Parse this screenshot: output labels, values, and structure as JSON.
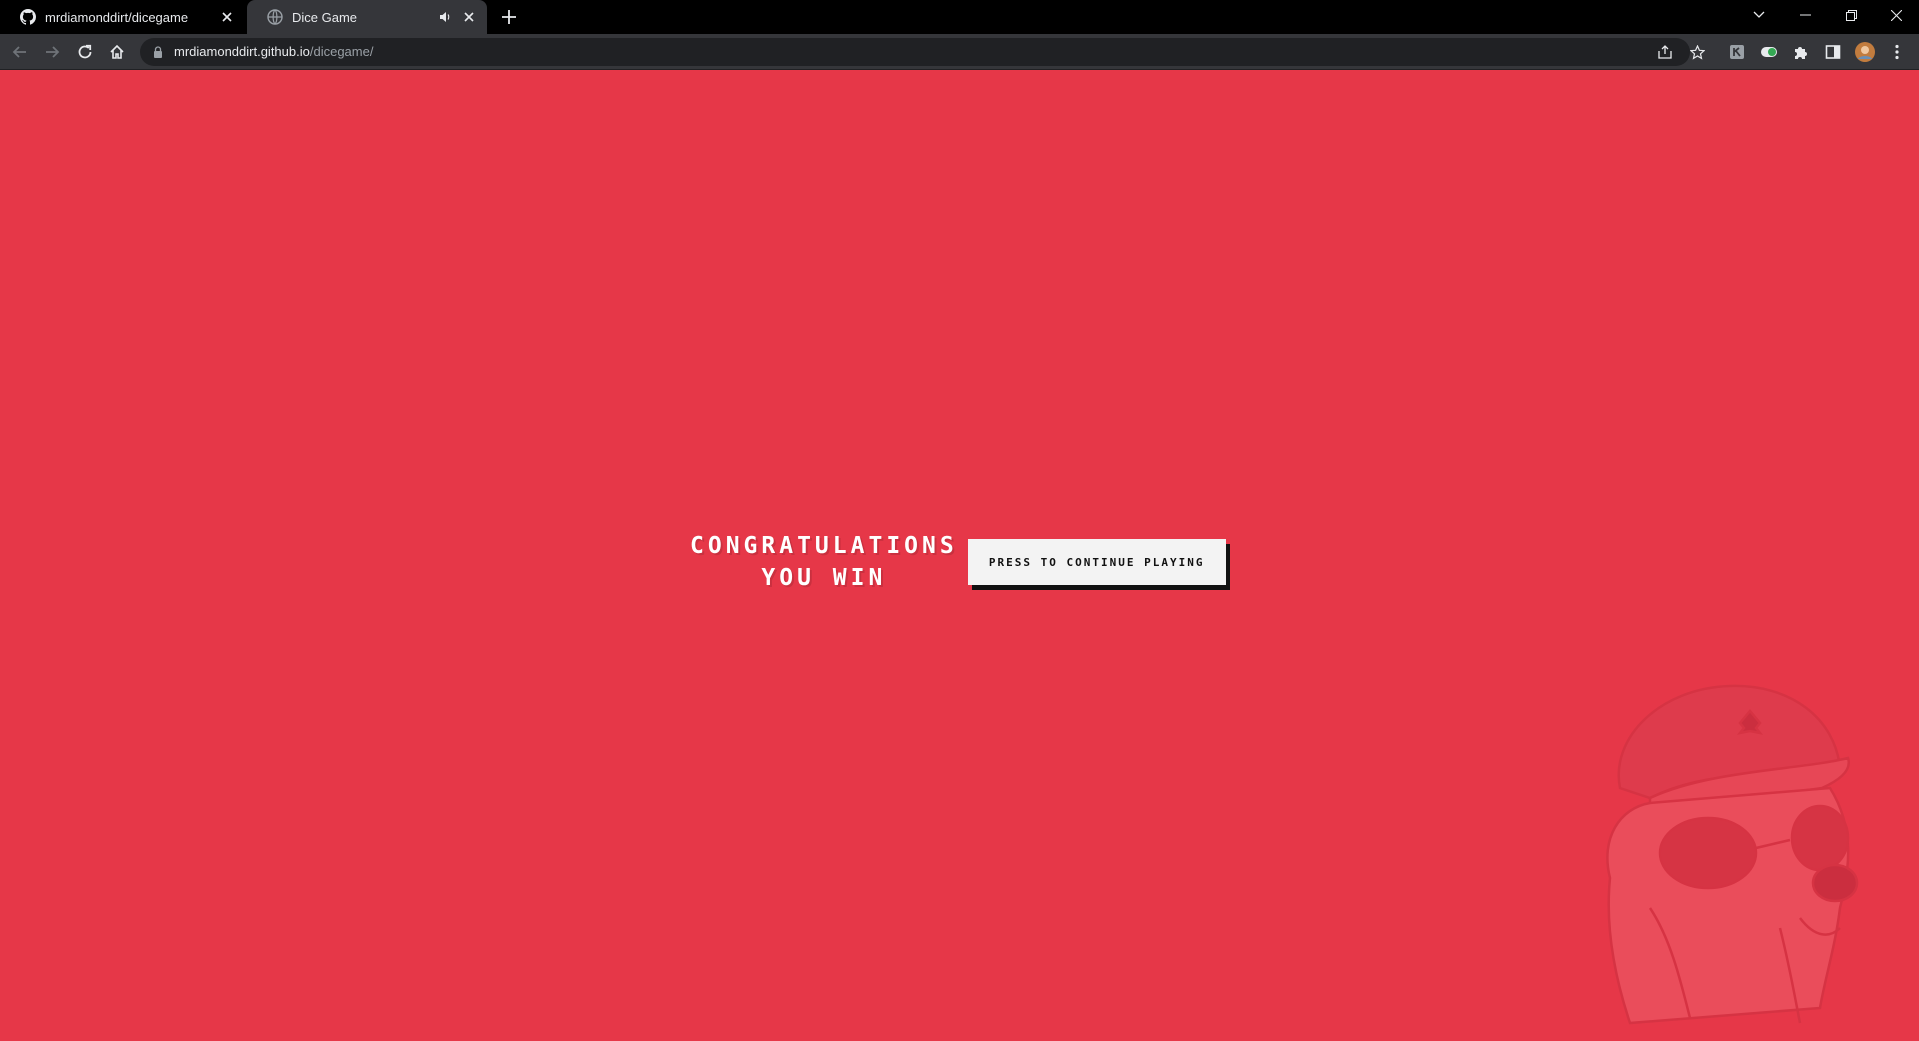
{
  "browser": {
    "tabs": [
      {
        "title": "mrdiamonddirt/dicegame",
        "favicon": "github-icon",
        "active": false
      },
      {
        "title": "Dice Game",
        "favicon": "globe-icon",
        "active": true,
        "audio": "speaker-icon"
      }
    ],
    "url": {
      "host": "mrdiamonddirt.github.io",
      "path": "/dicegame/"
    }
  },
  "game": {
    "message_line1": "CONGRATULATIONS",
    "message_line2": "YOU WIN",
    "continue_label": "PRESS TO CONTINUE PLAYING"
  },
  "colors": {
    "background": "#e63748",
    "button": "#f3f3f3",
    "tabstrip": "#000000",
    "toolbar": "#35363a"
  }
}
